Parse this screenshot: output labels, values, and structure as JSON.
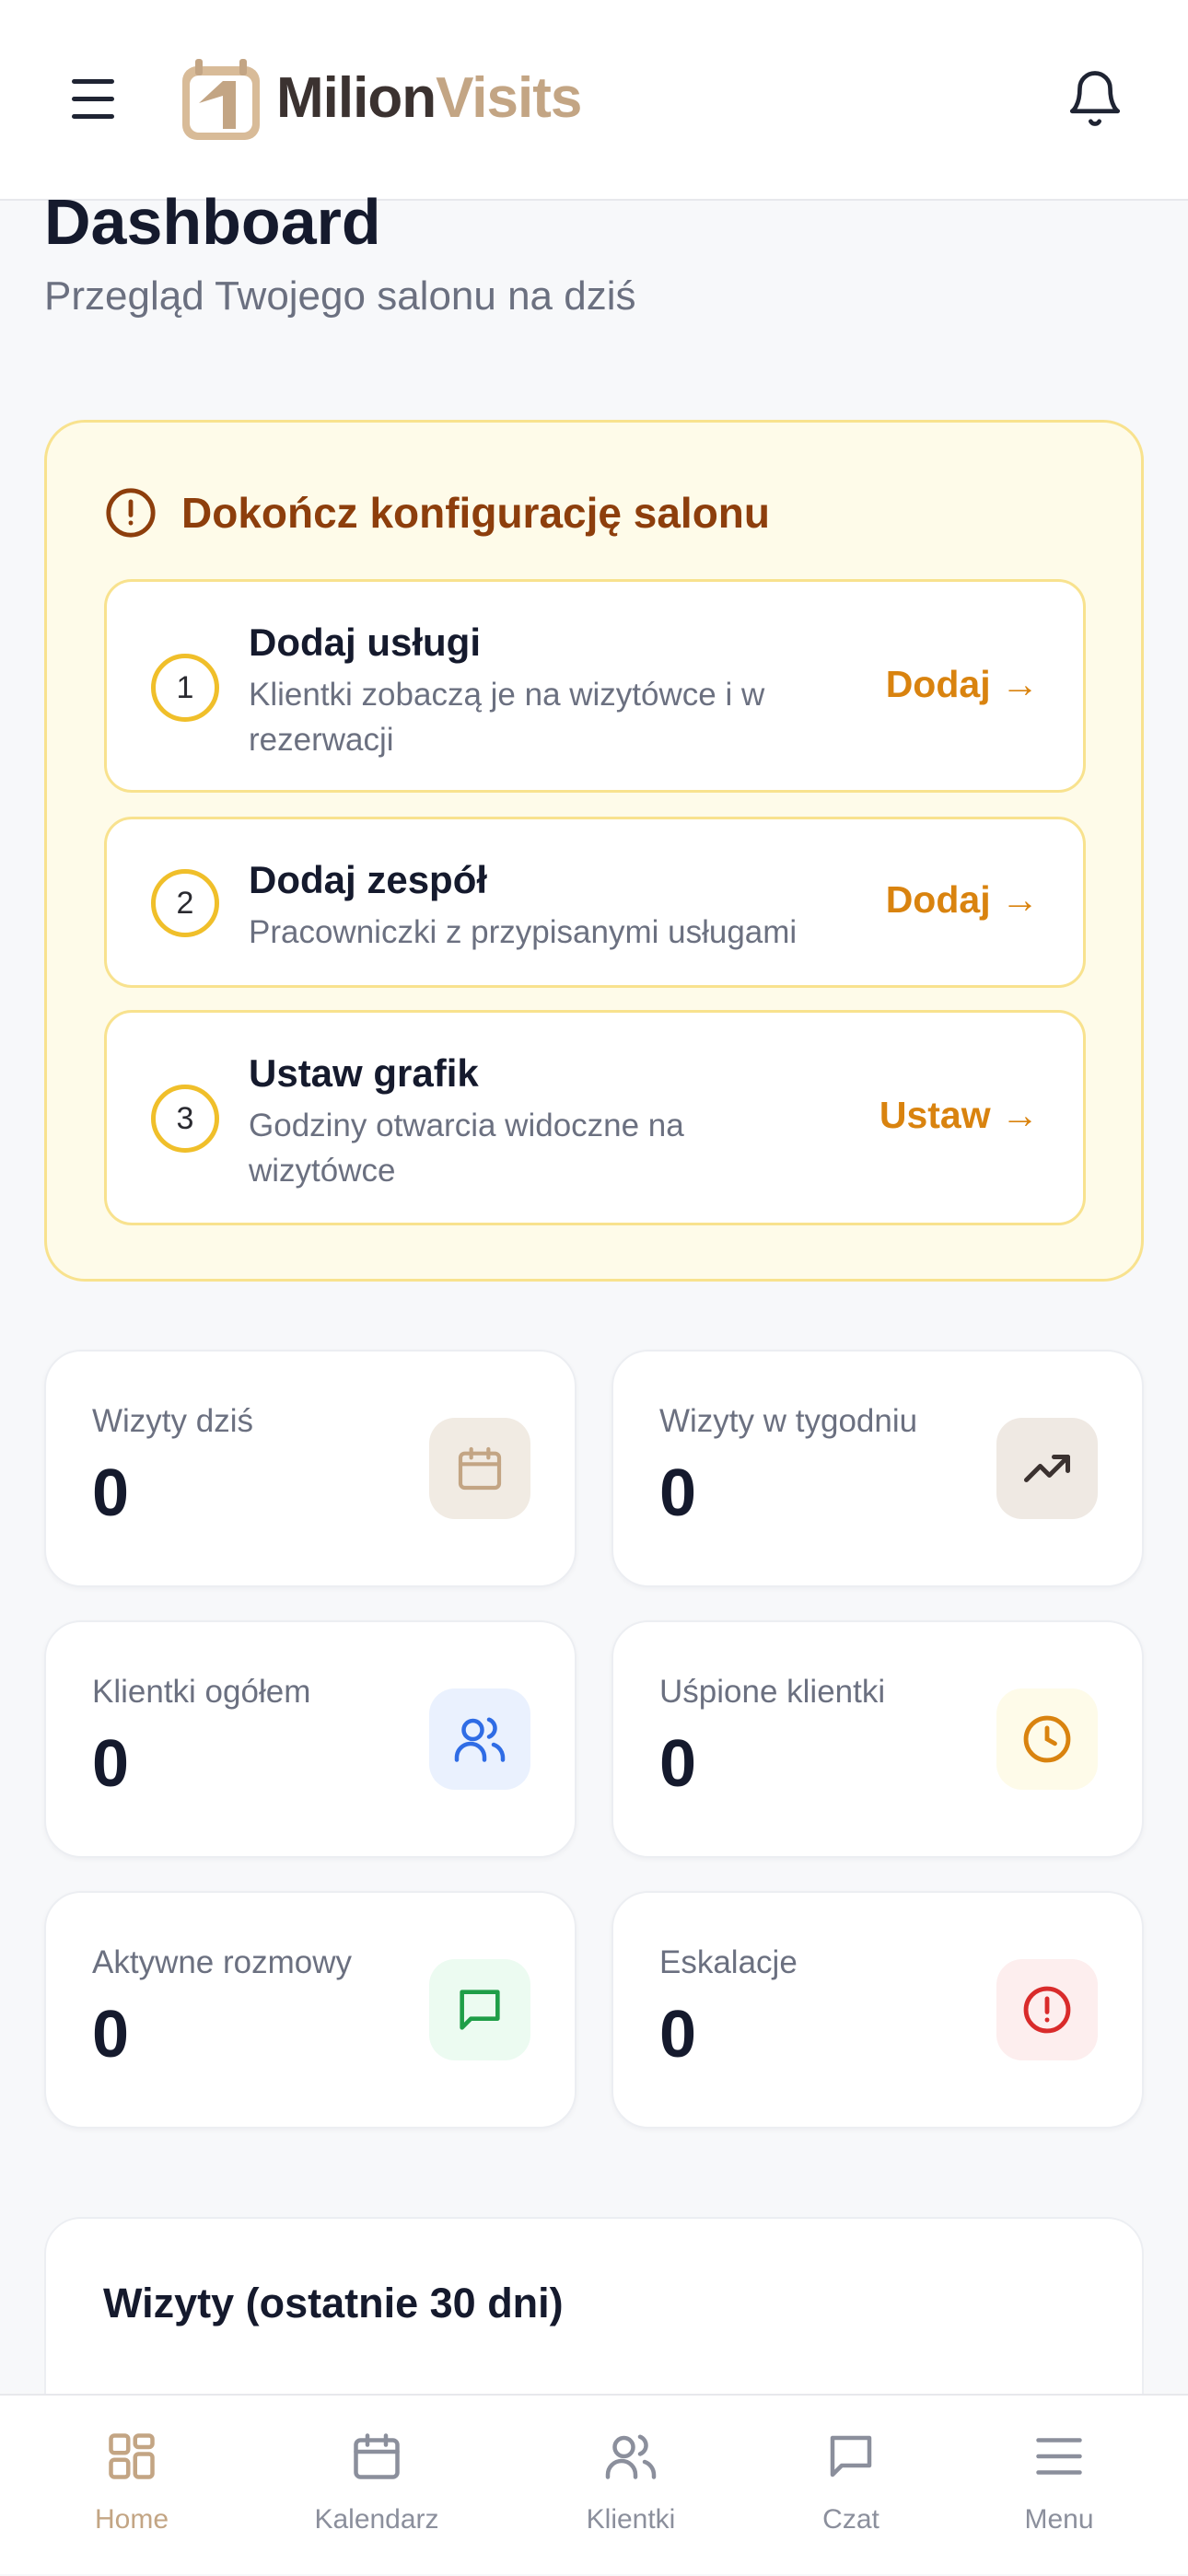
{
  "header": {
    "logo_text_primary": "Milion",
    "logo_text_accent": "Visits",
    "menu_icon": "hamburger-icon",
    "notification_icon": "bell-icon"
  },
  "page": {
    "title": "Dashboard",
    "subtitle": "Przegląd Twojego salonu na dziś"
  },
  "setup": {
    "title": "Dokończ konfigurację salonu",
    "steps": [
      {
        "number": "1",
        "title": "Dodaj usługi",
        "description": "Klientki zobaczą je na wizytówce i w rezerwacji",
        "action": "Dodaj →"
      },
      {
        "number": "2",
        "title": "Dodaj zespół",
        "description": "Pracowniczki z przypisanymi usługami",
        "action": "Dodaj →"
      },
      {
        "number": "3",
        "title": "Ustaw grafik",
        "description": "Godziny otwarcia widoczne na wizytówce",
        "action": "Ustaw →"
      }
    ]
  },
  "stats": [
    {
      "label": "Wizyty dziś",
      "value": "0",
      "icon": "calendar-icon"
    },
    {
      "label": "Wizyty w tygodniu",
      "value": "0",
      "icon": "trending-up-icon"
    },
    {
      "label": "Klientki ogółem",
      "value": "0",
      "icon": "users-icon"
    },
    {
      "label": "Uśpione klientki",
      "value": "0",
      "icon": "clock-icon"
    },
    {
      "label": "Aktywne rozmowy",
      "value": "0",
      "icon": "chat-icon"
    },
    {
      "label": "Eskalacje",
      "value": "0",
      "icon": "alert-circle-icon"
    }
  ],
  "chart_section": {
    "title": "Wizyty (ostatnie 30 dni)"
  },
  "bottom_nav": [
    {
      "label": "Home",
      "icon": "grid-icon",
      "active": true
    },
    {
      "label": "Kalendarz",
      "icon": "calendar-icon",
      "active": false
    },
    {
      "label": "Klientki",
      "icon": "users-icon",
      "active": false
    },
    {
      "label": "Czat",
      "icon": "chat-icon",
      "active": false
    },
    {
      "label": "Menu",
      "icon": "menu-icon",
      "active": false
    }
  ],
  "colors": {
    "brand": "#c3a584",
    "brand_dark": "#3b3230",
    "warning_bg": "#fefbe9",
    "warning_border": "#f8e28e",
    "warning_text": "#8d3e0c",
    "action": "#d9830f"
  }
}
